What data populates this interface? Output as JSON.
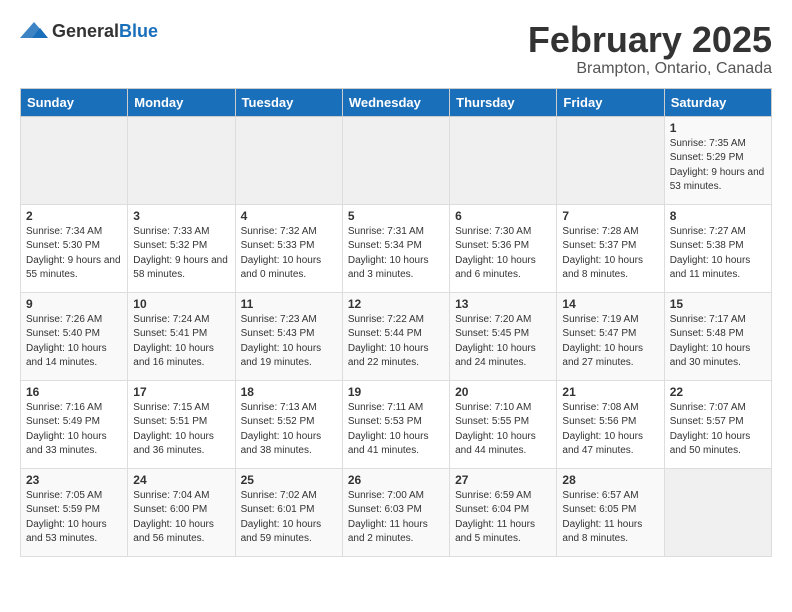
{
  "header": {
    "logo_general": "General",
    "logo_blue": "Blue",
    "month": "February 2025",
    "location": "Brampton, Ontario, Canada"
  },
  "days_of_week": [
    "Sunday",
    "Monday",
    "Tuesday",
    "Wednesday",
    "Thursday",
    "Friday",
    "Saturday"
  ],
  "weeks": [
    [
      {
        "day": "",
        "info": ""
      },
      {
        "day": "",
        "info": ""
      },
      {
        "day": "",
        "info": ""
      },
      {
        "day": "",
        "info": ""
      },
      {
        "day": "",
        "info": ""
      },
      {
        "day": "",
        "info": ""
      },
      {
        "day": "1",
        "info": "Sunrise: 7:35 AM\nSunset: 5:29 PM\nDaylight: 9 hours and 53 minutes."
      }
    ],
    [
      {
        "day": "2",
        "info": "Sunrise: 7:34 AM\nSunset: 5:30 PM\nDaylight: 9 hours and 55 minutes."
      },
      {
        "day": "3",
        "info": "Sunrise: 7:33 AM\nSunset: 5:32 PM\nDaylight: 9 hours and 58 minutes."
      },
      {
        "day": "4",
        "info": "Sunrise: 7:32 AM\nSunset: 5:33 PM\nDaylight: 10 hours and 0 minutes."
      },
      {
        "day": "5",
        "info": "Sunrise: 7:31 AM\nSunset: 5:34 PM\nDaylight: 10 hours and 3 minutes."
      },
      {
        "day": "6",
        "info": "Sunrise: 7:30 AM\nSunset: 5:36 PM\nDaylight: 10 hours and 6 minutes."
      },
      {
        "day": "7",
        "info": "Sunrise: 7:28 AM\nSunset: 5:37 PM\nDaylight: 10 hours and 8 minutes."
      },
      {
        "day": "8",
        "info": "Sunrise: 7:27 AM\nSunset: 5:38 PM\nDaylight: 10 hours and 11 minutes."
      }
    ],
    [
      {
        "day": "9",
        "info": "Sunrise: 7:26 AM\nSunset: 5:40 PM\nDaylight: 10 hours and 14 minutes."
      },
      {
        "day": "10",
        "info": "Sunrise: 7:24 AM\nSunset: 5:41 PM\nDaylight: 10 hours and 16 minutes."
      },
      {
        "day": "11",
        "info": "Sunrise: 7:23 AM\nSunset: 5:43 PM\nDaylight: 10 hours and 19 minutes."
      },
      {
        "day": "12",
        "info": "Sunrise: 7:22 AM\nSunset: 5:44 PM\nDaylight: 10 hours and 22 minutes."
      },
      {
        "day": "13",
        "info": "Sunrise: 7:20 AM\nSunset: 5:45 PM\nDaylight: 10 hours and 24 minutes."
      },
      {
        "day": "14",
        "info": "Sunrise: 7:19 AM\nSunset: 5:47 PM\nDaylight: 10 hours and 27 minutes."
      },
      {
        "day": "15",
        "info": "Sunrise: 7:17 AM\nSunset: 5:48 PM\nDaylight: 10 hours and 30 minutes."
      }
    ],
    [
      {
        "day": "16",
        "info": "Sunrise: 7:16 AM\nSunset: 5:49 PM\nDaylight: 10 hours and 33 minutes."
      },
      {
        "day": "17",
        "info": "Sunrise: 7:15 AM\nSunset: 5:51 PM\nDaylight: 10 hours and 36 minutes."
      },
      {
        "day": "18",
        "info": "Sunrise: 7:13 AM\nSunset: 5:52 PM\nDaylight: 10 hours and 38 minutes."
      },
      {
        "day": "19",
        "info": "Sunrise: 7:11 AM\nSunset: 5:53 PM\nDaylight: 10 hours and 41 minutes."
      },
      {
        "day": "20",
        "info": "Sunrise: 7:10 AM\nSunset: 5:55 PM\nDaylight: 10 hours and 44 minutes."
      },
      {
        "day": "21",
        "info": "Sunrise: 7:08 AM\nSunset: 5:56 PM\nDaylight: 10 hours and 47 minutes."
      },
      {
        "day": "22",
        "info": "Sunrise: 7:07 AM\nSunset: 5:57 PM\nDaylight: 10 hours and 50 minutes."
      }
    ],
    [
      {
        "day": "23",
        "info": "Sunrise: 7:05 AM\nSunset: 5:59 PM\nDaylight: 10 hours and 53 minutes."
      },
      {
        "day": "24",
        "info": "Sunrise: 7:04 AM\nSunset: 6:00 PM\nDaylight: 10 hours and 56 minutes."
      },
      {
        "day": "25",
        "info": "Sunrise: 7:02 AM\nSunset: 6:01 PM\nDaylight: 10 hours and 59 minutes."
      },
      {
        "day": "26",
        "info": "Sunrise: 7:00 AM\nSunset: 6:03 PM\nDaylight: 11 hours and 2 minutes."
      },
      {
        "day": "27",
        "info": "Sunrise: 6:59 AM\nSunset: 6:04 PM\nDaylight: 11 hours and 5 minutes."
      },
      {
        "day": "28",
        "info": "Sunrise: 6:57 AM\nSunset: 6:05 PM\nDaylight: 11 hours and 8 minutes."
      },
      {
        "day": "",
        "info": ""
      }
    ]
  ]
}
